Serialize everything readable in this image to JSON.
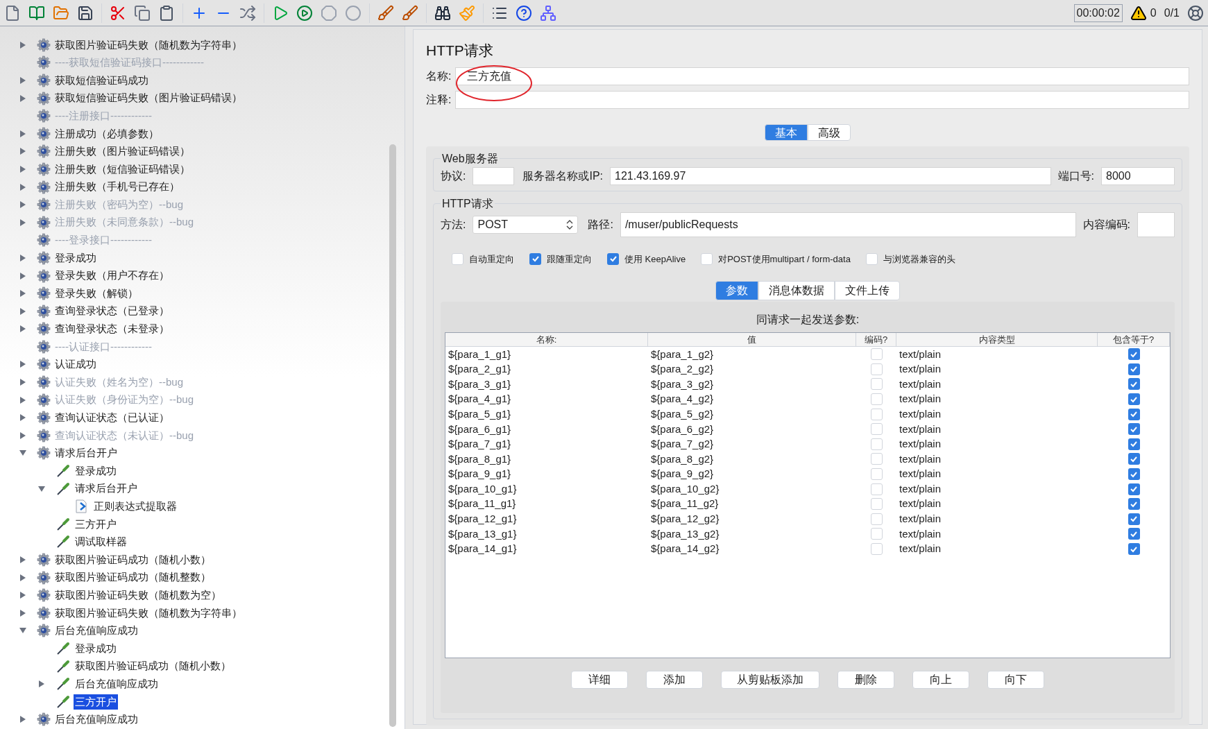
{
  "toolbar": {
    "timer": "00:00:02",
    "warnings": "0",
    "threads": "0/1"
  },
  "tree": [
    {
      "label": "获取图片验证码失败（随机数为字符串）",
      "kind": "group",
      "disabled": false,
      "selected": false,
      "expanded": false
    },
    {
      "label": "----获取短信验证码接口------------",
      "kind": "group",
      "disabled": true,
      "selected": false
    },
    {
      "label": "获取短信验证码成功",
      "kind": "group",
      "disabled": false,
      "selected": false,
      "expanded": false
    },
    {
      "label": "获取短信验证码失败（图片验证码错误）",
      "kind": "group",
      "disabled": false,
      "selected": false,
      "expanded": false
    },
    {
      "label": "----注册接口------------",
      "kind": "group",
      "disabled": true,
      "selected": false
    },
    {
      "label": "注册成功（必填参数）",
      "kind": "group",
      "disabled": false,
      "selected": false,
      "expanded": false
    },
    {
      "label": "注册失败（图片验证码错误）",
      "kind": "group",
      "disabled": false,
      "selected": false,
      "expanded": false
    },
    {
      "label": "注册失败（短信验证码错误）",
      "kind": "group",
      "disabled": false,
      "selected": false,
      "expanded": false
    },
    {
      "label": "注册失败（手机号已存在）",
      "kind": "group",
      "disabled": false,
      "selected": false,
      "expanded": false
    },
    {
      "label": "注册失败（密码为空）--bug",
      "kind": "group",
      "disabled": true,
      "selected": false,
      "expanded": false
    },
    {
      "label": "注册失败（未同意条款）--bug",
      "kind": "group",
      "disabled": true,
      "selected": false,
      "expanded": false
    },
    {
      "label": "----登录接口------------",
      "kind": "group",
      "disabled": true,
      "selected": false
    },
    {
      "label": "登录成功",
      "kind": "group",
      "disabled": false,
      "selected": false,
      "expanded": false
    },
    {
      "label": "登录失败（用户不存在）",
      "kind": "group",
      "disabled": false,
      "selected": false,
      "expanded": false
    },
    {
      "label": "登录失败（解锁）",
      "kind": "group",
      "disabled": false,
      "selected": false,
      "expanded": false
    },
    {
      "label": "查询登录状态（已登录）",
      "kind": "group",
      "disabled": false,
      "selected": false,
      "expanded": false
    },
    {
      "label": "查询登录状态（未登录）",
      "kind": "group",
      "disabled": false,
      "selected": false,
      "expanded": false
    },
    {
      "label": "----认证接口------------",
      "kind": "group",
      "disabled": true,
      "selected": false
    },
    {
      "label": "认证成功",
      "kind": "group",
      "disabled": false,
      "selected": false,
      "expanded": false
    },
    {
      "label": "认证失败（姓名为空）--bug",
      "kind": "group",
      "disabled": true,
      "selected": false,
      "expanded": false
    },
    {
      "label": "认证失败（身份证为空）--bug",
      "kind": "group",
      "disabled": true,
      "selected": false,
      "expanded": false
    },
    {
      "label": "查询认证状态（已认证）",
      "kind": "group",
      "disabled": false,
      "selected": false,
      "expanded": false
    },
    {
      "label": "查询认证状态（未认证）--bug",
      "kind": "group",
      "disabled": true,
      "selected": false,
      "expanded": false
    },
    {
      "label": "请求后台开户",
      "kind": "group",
      "disabled": false,
      "selected": false,
      "expanded": true,
      "children": [
        {
          "label": "登录成功",
          "kind": "sampler",
          "disabled": false,
          "selected": false
        },
        {
          "label": "请求后台开户",
          "kind": "sampler",
          "disabled": false,
          "selected": false,
          "expanded": true,
          "children": [
            {
              "label": "正则表达式提取器",
              "kind": "extractor",
              "disabled": false,
              "selected": false
            }
          ]
        },
        {
          "label": "三方开户",
          "kind": "sampler",
          "disabled": false,
          "selected": false
        },
        {
          "label": "调试取样器",
          "kind": "sampler",
          "disabled": false,
          "selected": false
        }
      ]
    },
    {
      "label": "获取图片验证码成功（随机小数）",
      "kind": "group",
      "disabled": false,
      "selected": false,
      "expanded": false
    },
    {
      "label": "获取图片验证码成功（随机整数）",
      "kind": "group",
      "disabled": false,
      "selected": false,
      "expanded": false
    },
    {
      "label": "获取图片验证码失败（随机数为空）",
      "kind": "group",
      "disabled": false,
      "selected": false,
      "expanded": false
    },
    {
      "label": "获取图片验证码失败（随机数为字符串）",
      "kind": "group",
      "disabled": false,
      "selected": false,
      "expanded": false
    },
    {
      "label": "后台充值响应成功",
      "kind": "group",
      "disabled": false,
      "selected": false,
      "expanded": true,
      "children": [
        {
          "label": "登录成功",
          "kind": "sampler",
          "disabled": false,
          "selected": false
        },
        {
          "label": "获取图片验证码成功（随机小数）",
          "kind": "sampler",
          "disabled": false,
          "selected": false
        },
        {
          "label": "后台充值响应成功",
          "kind": "sampler",
          "disabled": false,
          "selected": false,
          "expanded": false
        },
        {
          "label": "三方开户",
          "kind": "sampler",
          "disabled": false,
          "selected": true
        }
      ]
    },
    {
      "label": "后台充值响应成功",
      "kind": "group",
      "disabled": false,
      "selected": false,
      "expanded": false
    }
  ],
  "panel": {
    "title": "HTTP请求",
    "name": {
      "label": "名称:",
      "value": "三方充值"
    },
    "comment": {
      "label": "注释:"
    },
    "tabs": [
      {
        "label": "基本",
        "selected": true
      },
      {
        "label": "高级",
        "selected": false
      }
    ],
    "web_server": {
      "legend": "Web服务器",
      "protocol_label": "协议:",
      "server_label": "服务器名称或IP:",
      "server": "121.43.169.97",
      "port_label": "端口号:",
      "port": "8000"
    },
    "http_request": {
      "legend": "HTTP请求",
      "method_label": "方法:",
      "method": "POST",
      "path_label": "路径:",
      "path": "/muser/publicRequests",
      "encoding_label": "内容编码:",
      "options": [
        {
          "label": "自动重定向",
          "checked": false
        },
        {
          "label": "跟随重定向",
          "checked": true
        },
        {
          "label": "使用 KeepAlive",
          "checked": true
        },
        {
          "label": "对POST使用multipart / form-data",
          "checked": false
        },
        {
          "label": "与浏览器兼容的头",
          "checked": false
        }
      ]
    },
    "body_tabs": [
      {
        "label": "参数",
        "selected": true
      },
      {
        "label": "消息体数据",
        "selected": false
      },
      {
        "label": "文件上传",
        "selected": false
      }
    ],
    "params_title": "同请求一起发送参数:",
    "columns": [
      "名称:",
      "值",
      "编码?",
      "内容类型",
      "包含等于?"
    ],
    "rows": [
      {
        "name": "${para_1_g1}",
        "value": "${para_1_g2}",
        "encode": false,
        "type": "text/plain",
        "include_equals": true
      },
      {
        "name": "${para_2_g1}",
        "value": "${para_2_g2}",
        "encode": false,
        "type": "text/plain",
        "include_equals": true
      },
      {
        "name": "${para_3_g1}",
        "value": "${para_3_g2}",
        "encode": false,
        "type": "text/plain",
        "include_equals": true
      },
      {
        "name": "${para_4_g1}",
        "value": "${para_4_g2}",
        "encode": false,
        "type": "text/plain",
        "include_equals": true
      },
      {
        "name": "${para_5_g1}",
        "value": "${para_5_g2}",
        "encode": false,
        "type": "text/plain",
        "include_equals": true
      },
      {
        "name": "${para_6_g1}",
        "value": "${para_6_g2}",
        "encode": false,
        "type": "text/plain",
        "include_equals": true
      },
      {
        "name": "${para_7_g1}",
        "value": "${para_7_g2}",
        "encode": false,
        "type": "text/plain",
        "include_equals": true
      },
      {
        "name": "${para_8_g1}",
        "value": "${para_8_g2}",
        "encode": false,
        "type": "text/plain",
        "include_equals": true
      },
      {
        "name": "${para_9_g1}",
        "value": "${para_9_g2}",
        "encode": false,
        "type": "text/plain",
        "include_equals": true
      },
      {
        "name": "${para_10_g1}",
        "value": "${para_10_g2}",
        "encode": false,
        "type": "text/plain",
        "include_equals": true
      },
      {
        "name": "${para_11_g1}",
        "value": "${para_11_g2}",
        "encode": false,
        "type": "text/plain",
        "include_equals": true
      },
      {
        "name": "${para_12_g1}",
        "value": "${para_12_g2}",
        "encode": false,
        "type": "text/plain",
        "include_equals": true
      },
      {
        "name": "${para_13_g1}",
        "value": "${para_13_g2}",
        "encode": false,
        "type": "text/plain",
        "include_equals": true
      },
      {
        "name": "${para_14_g1}",
        "value": "${para_14_g2}",
        "encode": false,
        "type": "text/plain",
        "include_equals": true
      }
    ],
    "buttons": [
      "详细",
      "添加",
      "从剪贴板添加",
      "删除",
      "向上",
      "向下"
    ]
  }
}
